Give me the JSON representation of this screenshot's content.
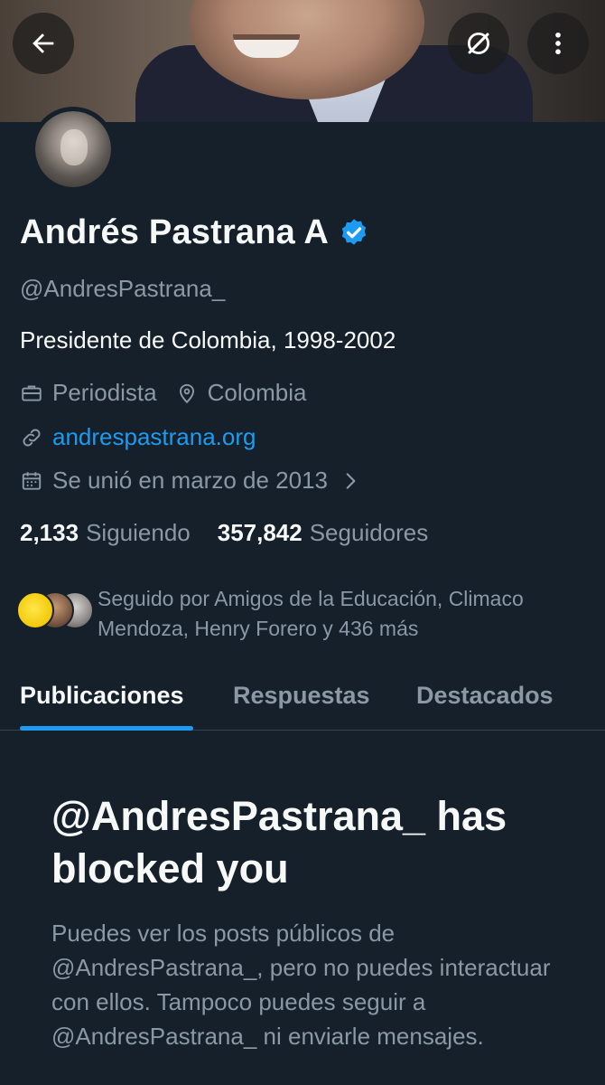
{
  "header": {
    "back_icon": "arrow-left-icon",
    "grok_icon": "grok-icon",
    "more_icon": "more-vertical-icon"
  },
  "profile": {
    "name": "Andrés Pastrana A",
    "verified": true,
    "handle": "@AndresPastrana_",
    "bio": "Presidente de Colombia, 1998-2002",
    "profession": "Periodista",
    "location": "Colombia",
    "website": "andrespastrana.org",
    "joined": "Se unió en marzo de 2013"
  },
  "stats": {
    "following_count": "2,133",
    "following_label": "Siguiendo",
    "followers_count": "357,842",
    "followers_label": "Seguidores"
  },
  "followed_by": "Seguido por Amigos de la Educación, Climaco Mendoza, Henry Forero y 436 más",
  "tabs": [
    "Publicaciones",
    "Respuestas",
    "Destacados"
  ],
  "blocked": {
    "title": "@AndresPastrana_ has blocked you",
    "description": "Puedes ver los posts públicos de @AndresPastrana_, pero no puedes interactuar con ellos. Tampoco puedes seguir a @AndresPastrana_ ni enviarle mensajes."
  },
  "colors": {
    "background": "#15202b",
    "accent": "#1d9bf0",
    "muted": "#8b98a5"
  }
}
